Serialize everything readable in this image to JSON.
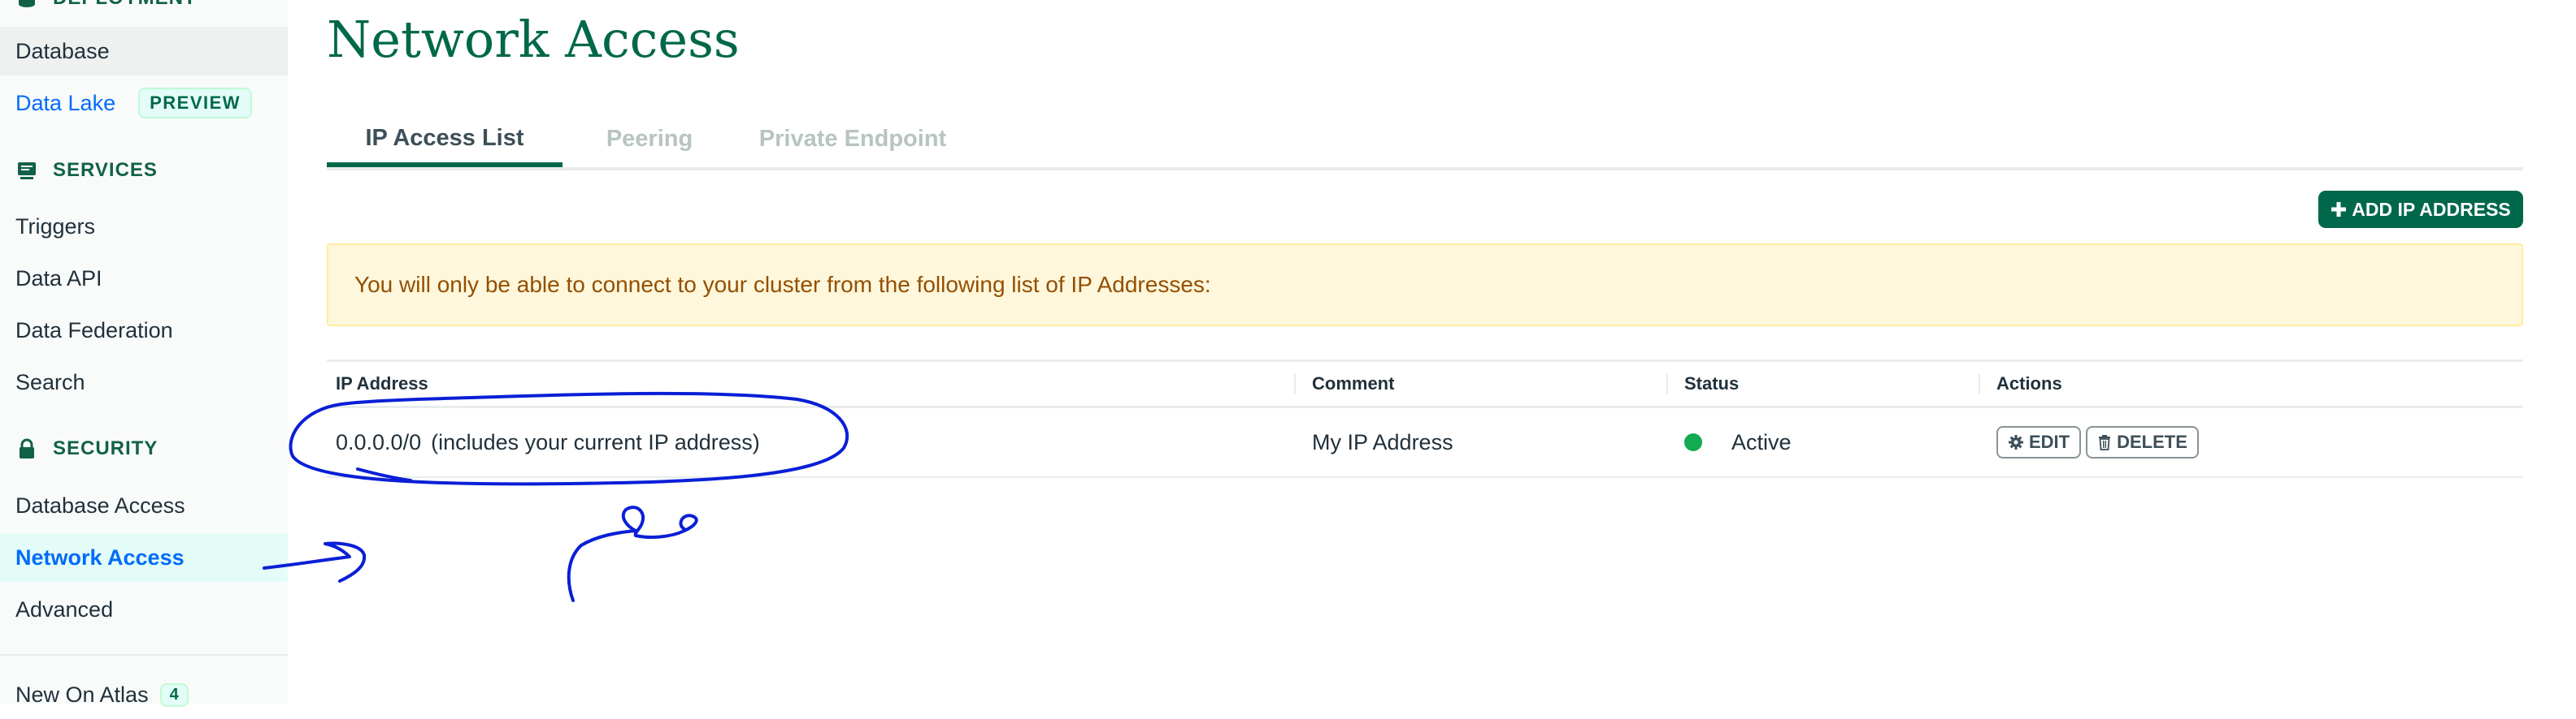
{
  "sidebar": {
    "deployment_label": "DEPLOYMENT",
    "database": "Database",
    "data_lake": "Data Lake",
    "data_lake_badge": "PREVIEW",
    "services_label": "SERVICES",
    "triggers": "Triggers",
    "data_api": "Data API",
    "data_federation": "Data Federation",
    "search": "Search",
    "security_label": "SECURITY",
    "database_access": "Database Access",
    "network_access": "Network Access",
    "advanced": "Advanced",
    "new_on_atlas": "New On Atlas",
    "new_on_atlas_count": "4"
  },
  "page": {
    "title": "Network Access",
    "tabs": [
      "IP Access List",
      "Peering",
      "Private Endpoint"
    ],
    "active_tab": "IP Access List",
    "add_button": "ADD IP ADDRESS",
    "banner": "You will only be able to connect to your cluster from the following list of IP Addresses:"
  },
  "table": {
    "headers": [
      "IP Address",
      "Comment",
      "Status",
      "Actions"
    ],
    "rows": [
      {
        "ip": "0.0.0.0/0",
        "ip_note": "(includes your current IP address)",
        "comment": "My IP Address",
        "status": "Active",
        "edit": "EDIT",
        "delete": "DELETE"
      }
    ]
  },
  "colors": {
    "brand_green": "#00684a",
    "active_blue": "#016bf8",
    "status_green": "#13aa52",
    "banner_bg": "#fef7db",
    "annotation_ink": "#0a1fd6"
  },
  "icons": [
    "database-icon",
    "services-icon",
    "lock-icon",
    "plus-icon",
    "gear-icon",
    "trash-icon",
    "status-dot"
  ]
}
